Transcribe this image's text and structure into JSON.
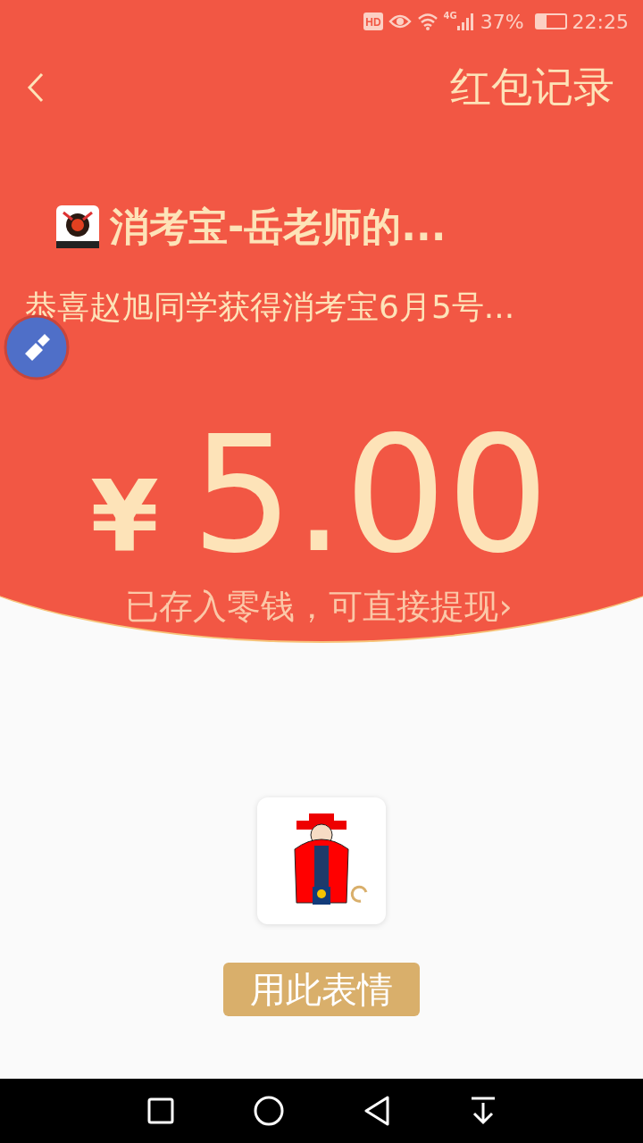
{
  "status_bar": {
    "hd_badge": "HD",
    "network": "4G",
    "battery_text": "37%",
    "battery": {
      "level": 0.37
    },
    "time": "22:25"
  },
  "header": {
    "title": "红包记录"
  },
  "sender": {
    "name": "消考宝-岳老师的...",
    "message": "恭喜赵旭同学获得消考宝6月5号..."
  },
  "amount": {
    "currency": "¥",
    "value": "5.00"
  },
  "link": "已存入零钱，可直接提现›",
  "button": "用此表情"
}
